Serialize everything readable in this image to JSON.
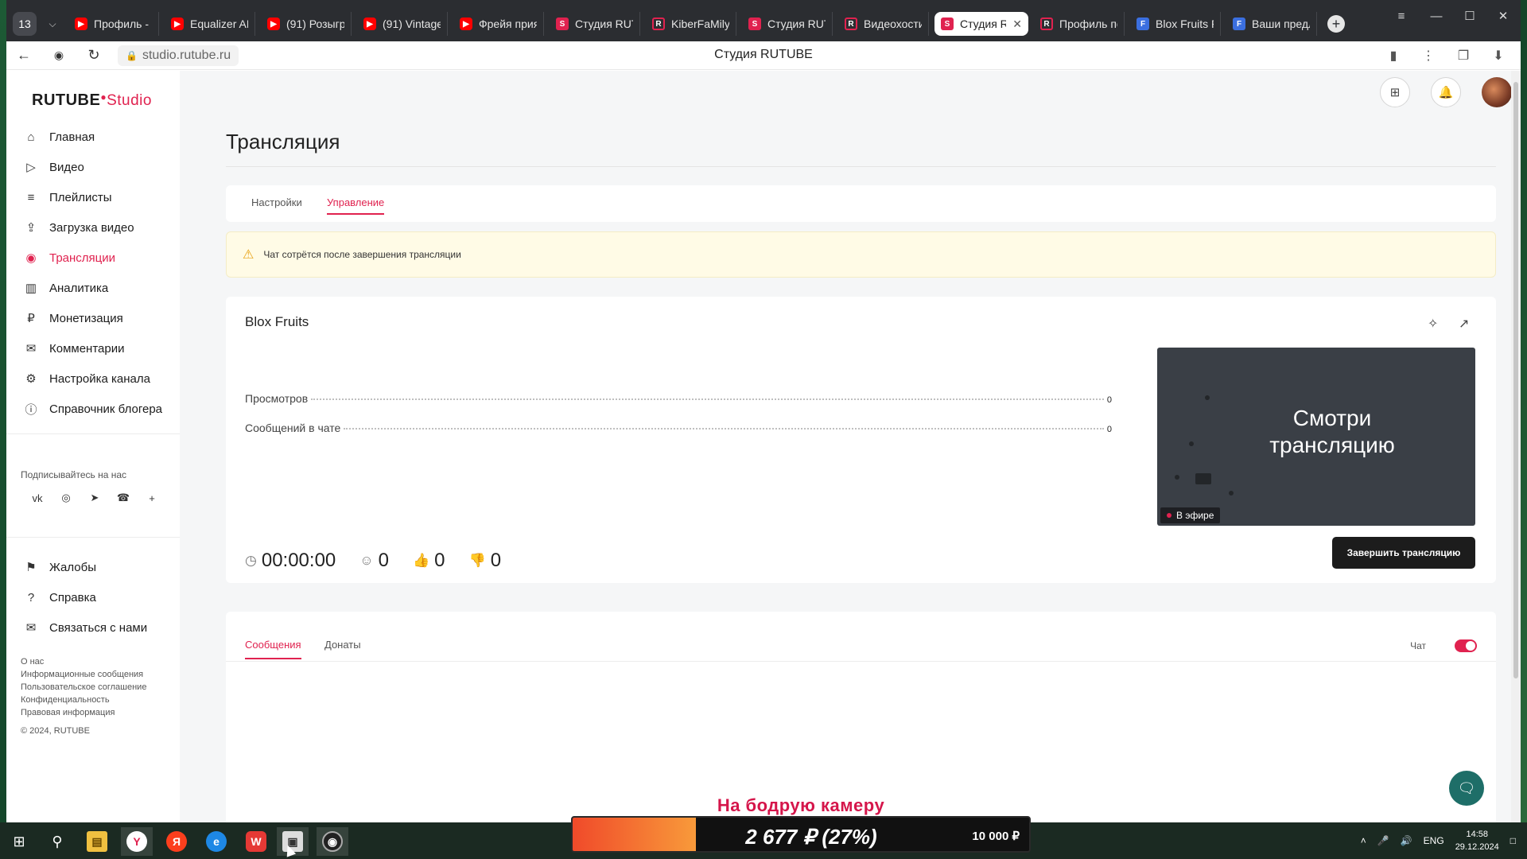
{
  "browser": {
    "tab_count": "13",
    "tabs": [
      {
        "label": "Профиль - Р",
        "fav": "yt"
      },
      {
        "label": "Equalizer AP",
        "fav": "yt"
      },
      {
        "label": "(91) Розыгр",
        "fav": "yt"
      },
      {
        "label": "(91) Vintage",
        "fav": "yt"
      },
      {
        "label": "Фрейя прия",
        "fav": "yt"
      },
      {
        "label": "Студия RUT",
        "fav": "st"
      },
      {
        "label": "KiberFaMily",
        "fav": "rt"
      },
      {
        "label": "Студия RUT",
        "fav": "st"
      },
      {
        "label": "Видеохости",
        "fav": "rt"
      },
      {
        "label": "Студия R",
        "fav": "st",
        "active": true
      },
      {
        "label": "Профиль по",
        "fav": "rt"
      },
      {
        "label": "Blox Fruits R",
        "fav": "fb"
      },
      {
        "label": "Ваши предл",
        "fav": "fb"
      }
    ],
    "url": "studio.rutube.ru",
    "page_title": "Студия RUTUBE"
  },
  "sidebar": {
    "logo_main": "RUTUBE",
    "logo_sub": "Studio",
    "nav": [
      {
        "label": "Главная",
        "icon": "home-icon"
      },
      {
        "label": "Видео",
        "icon": "video-icon"
      },
      {
        "label": "Плейлисты",
        "icon": "playlist-icon"
      },
      {
        "label": "Загрузка видео",
        "icon": "upload-icon"
      },
      {
        "label": "Трансляции",
        "icon": "broadcast-icon",
        "active": true
      },
      {
        "label": "Аналитика",
        "icon": "analytics-icon"
      },
      {
        "label": "Монетизация",
        "icon": "monetization-icon"
      },
      {
        "label": "Комментарии",
        "icon": "comments-icon"
      },
      {
        "label": "Настройка канала",
        "icon": "settings-icon"
      },
      {
        "label": "Справочник блогера",
        "icon": "info-icon"
      }
    ],
    "follow_label": "Подписывайтесь на нас",
    "socials": [
      "vk-icon",
      "ok-icon",
      "telegram-icon",
      "viber-icon",
      "more-icon"
    ],
    "secondary_nav": [
      {
        "label": "Жалобы",
        "icon": "flag-icon"
      },
      {
        "label": "Справка",
        "icon": "help-icon"
      },
      {
        "label": "Связаться с нами",
        "icon": "mail-icon"
      }
    ],
    "footer_links": [
      "О нас",
      "Информационные сообщения",
      "Пользовательское соглашение",
      "Конфиденциальность",
      "Правовая информация"
    ],
    "copyright": "© 2024, RUTUBE"
  },
  "main": {
    "title": "Трансляция",
    "tabs": [
      {
        "label": "Настройки"
      },
      {
        "label": "Управление",
        "active": true
      }
    ],
    "warning": "Чат сотрётся после завершения трансляции",
    "stream": {
      "title": "Blox Fruits",
      "stats": [
        {
          "label": "Просмотров",
          "value": "0"
        },
        {
          "label": "Сообщений в чате",
          "value": "0"
        }
      ],
      "duration": "00:00:00",
      "viewers": "0",
      "likes": "0",
      "dislikes": "0",
      "preview_text": "Смотри трансляцию",
      "live_badge": "В эфире",
      "end_button": "Завершить трансляцию"
    },
    "chat": {
      "tabs": [
        {
          "label": "Сообщения",
          "active": true
        },
        {
          "label": "Донаты"
        }
      ],
      "toggle_label": "Чат",
      "toggle_on": true
    }
  },
  "overlay": {
    "donate_caption": "На бодрую камеру",
    "goal_current": "2 677 ₽ (27%)",
    "goal_target": "10 000 ₽",
    "goal_progress": 0.27
  },
  "taskbar": {
    "lang": "ENG",
    "time": "14:58",
    "date": "29.12.2024"
  },
  "colors": {
    "accent": "#e0224f",
    "button_dark": "#1c1c1c",
    "warning_bg": "#fffbe6"
  }
}
